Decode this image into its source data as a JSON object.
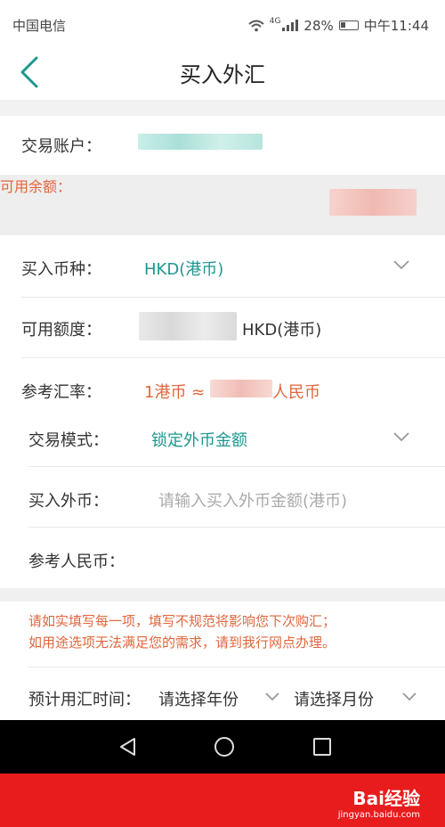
{
  "status_bar": {
    "carrier": "中国电信",
    "network": "4G",
    "battery": "28%",
    "time": "中午11:44"
  },
  "header": {
    "title": "买入外汇"
  },
  "account": {
    "label": "交易账户："
  },
  "balance": {
    "label": "可用余额："
  },
  "currency": {
    "label": "买入币种：",
    "value": "HKD(港币)"
  },
  "quota": {
    "label": "可用额度：",
    "unit": "HKD(港币)"
  },
  "rate": {
    "label": "参考汇率：",
    "prefix": "1港币 ≈",
    "suffix": "人民币"
  },
  "mode": {
    "label": "交易模式：",
    "value": "锁定外币金额"
  },
  "buy_amount": {
    "label": "买入外币：",
    "placeholder": "请输入买入外币金额(港币)"
  },
  "rmb_ref": {
    "label": "参考人民币："
  },
  "notice": {
    "lines": [
      "请如实填写每一项，填写不规范将影响您下次购汇；",
      "如用途选项无法满足您的需求，请到我行网点办理。"
    ]
  },
  "schedule": {
    "label": "预计用汇时间：",
    "year_placeholder": "请选择年份",
    "month_placeholder": "请选择月份"
  },
  "watermark": {
    "brand": "Bai经验",
    "url": "jingyan.baidu.com"
  },
  "colors": {
    "teal": "#1f9690",
    "orange": "#e0663c",
    "watermark_red": "#e81c1c"
  }
}
